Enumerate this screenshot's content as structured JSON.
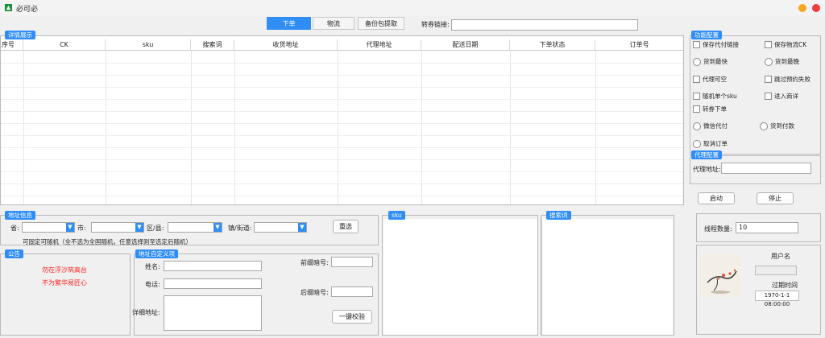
{
  "window": {
    "title": "必可必"
  },
  "tabs": [
    {
      "label": "下单",
      "active": true
    },
    {
      "label": "物流",
      "active": false
    },
    {
      "label": "备份包提取",
      "active": false
    }
  ],
  "voucher": {
    "label": "转券链接:",
    "value": ""
  },
  "details": {
    "title": "详情展示",
    "columns": [
      "序号",
      "CK",
      "sku",
      "搜索词",
      "收货地址",
      "代理地址",
      "配送日期",
      "下单状态",
      "订单号"
    ]
  },
  "functions": {
    "title": "功能配置",
    "options": [
      {
        "label": "保存代付链接",
        "kind": "checkbox"
      },
      {
        "label": "保存物流CK",
        "kind": "checkbox"
      },
      {
        "label": "货到最快",
        "kind": "radio"
      },
      {
        "label": "货到最晚",
        "kind": "radio"
      },
      {
        "label": "代理可空",
        "kind": "checkbox"
      },
      {
        "label": "跳过预约失败",
        "kind": "checkbox"
      },
      {
        "label": "随机单个sku",
        "kind": "checkbox"
      },
      {
        "label": "进入商详",
        "kind": "checkbox"
      },
      {
        "label": "转券下单",
        "kind": "checkbox"
      },
      {
        "label": "微信代付",
        "kind": "radio"
      },
      {
        "label": "货到付款",
        "kind": "radio"
      },
      {
        "label": "取消订单",
        "kind": "radio"
      }
    ]
  },
  "proxy": {
    "title": "代理配置",
    "label": "代理地址:",
    "value": ""
  },
  "actions": {
    "start": "启动",
    "stop": "停止"
  },
  "threads": {
    "label": "线程数量:",
    "value": "10"
  },
  "user": {
    "username_label": "用户名",
    "username": "",
    "expire_label": "过期时间",
    "expire": "1970-1-1 08:00:00"
  },
  "address": {
    "title": "地址信息",
    "province_label": "省:",
    "city_label": "市:",
    "district_label": "区/县:",
    "street_label": "镇/街道:",
    "reset": "重选",
    "note": "可固定可随机（全不选为全国随机，任意选择则至选定后随机）"
  },
  "notice": {
    "title": "公告",
    "line1": "勿在浮沙筑高台",
    "line2": "不为繁华易匠心"
  },
  "custom_address": {
    "title": "地址自定义项",
    "name_label": "姓名:",
    "phone_label": "电话:",
    "detail_label": "详细地址:",
    "prefix_label": "前缀暗号:",
    "suffix_label": "后缀暗号:",
    "verify": "一键校验"
  },
  "sku_panel": {
    "title": "sku"
  },
  "search_panel": {
    "title": "搜索词"
  },
  "colors": {
    "accent": "#2f8df5",
    "notice_red": "#ff2020",
    "minimize": "#f5a623",
    "close": "#ef3b3b"
  }
}
